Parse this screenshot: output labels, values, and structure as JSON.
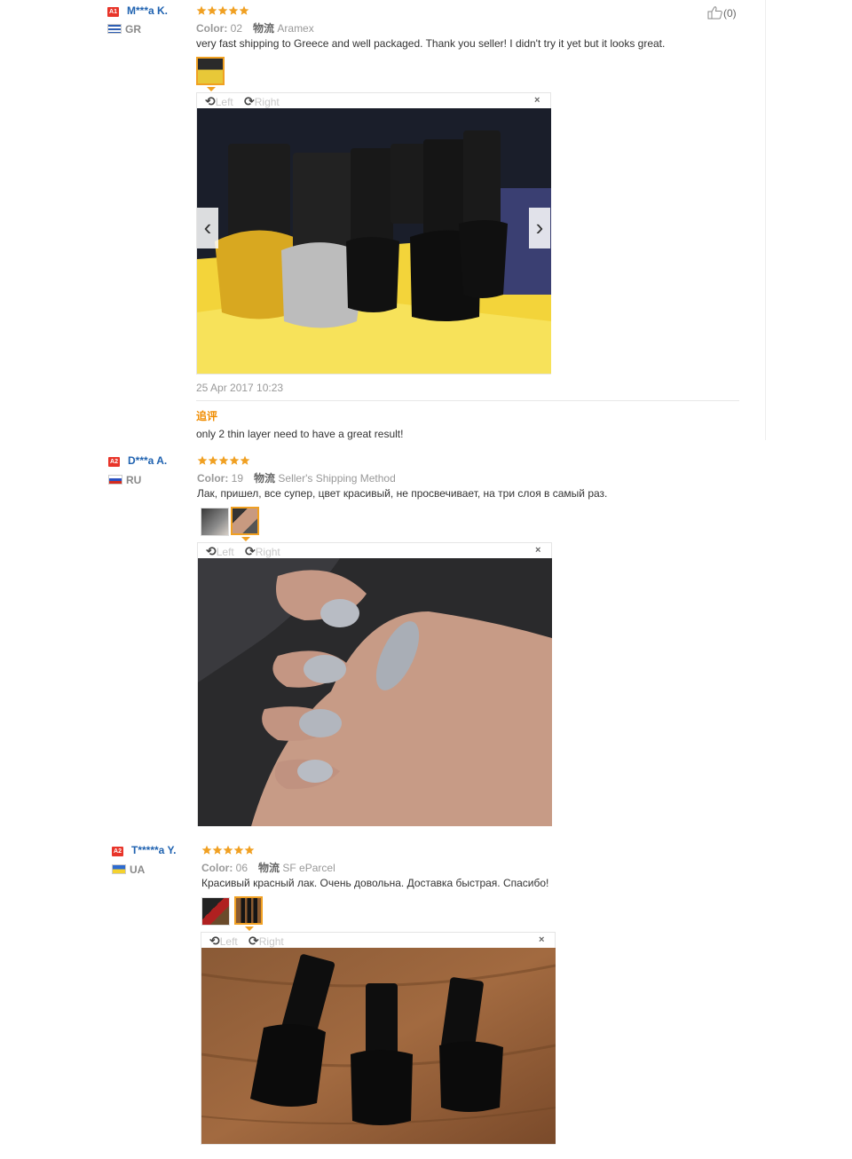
{
  "reviews": [
    {
      "level": "A1",
      "user": "M***a K.",
      "country": "GR",
      "stars": 5,
      "color_label": "Color:",
      "color_value": "02",
      "ship_label": "物流",
      "ship_value": "Aramex",
      "text": "very fast shipping to Greece and well packaged. Thank you seller! I didn't try it yet but it looks great.",
      "rotate_left": "Left",
      "rotate_right": "Right",
      "close": "×",
      "date": "25 Apr 2017 10:23",
      "additional_label": "追评",
      "additional_text": "only 2 thin layer need to have a great result!",
      "like_count": "(0)"
    },
    {
      "level": "A2",
      "user": "D***a A.",
      "country": "RU",
      "stars": 5,
      "color_label": "Color:",
      "color_value": "19",
      "ship_label": "物流",
      "ship_value": "Seller's Shipping Method",
      "text": "Лак, пришел, все супер, цвет красивый, не просвечивает, на три слоя в самый раз.",
      "rotate_left": "Left",
      "rotate_right": "Right",
      "close": "×"
    },
    {
      "level": "A2",
      "user": "T*****a Y.",
      "country": "UA",
      "stars": 5,
      "color_label": "Color:",
      "color_value": "06",
      "ship_label": "物流",
      "ship_value": "SF eParcel",
      "text": "Красивый красный лак. Очень довольна. Доставка быстрая. Спасибо!",
      "rotate_left": "Left",
      "rotate_right": "Right",
      "close": "×"
    }
  ],
  "colors": {
    "username": "#1f62b0",
    "star": "#f0a022",
    "level_badge": "#e8352a",
    "additional_label": "#f08c00"
  },
  "icons": {
    "like": "thumbs-up-icon",
    "rotate_left": "rotate-left-icon",
    "rotate_right": "rotate-right-icon",
    "prev": "chevron-left-icon",
    "next": "chevron-right-icon",
    "close": "close-icon"
  }
}
